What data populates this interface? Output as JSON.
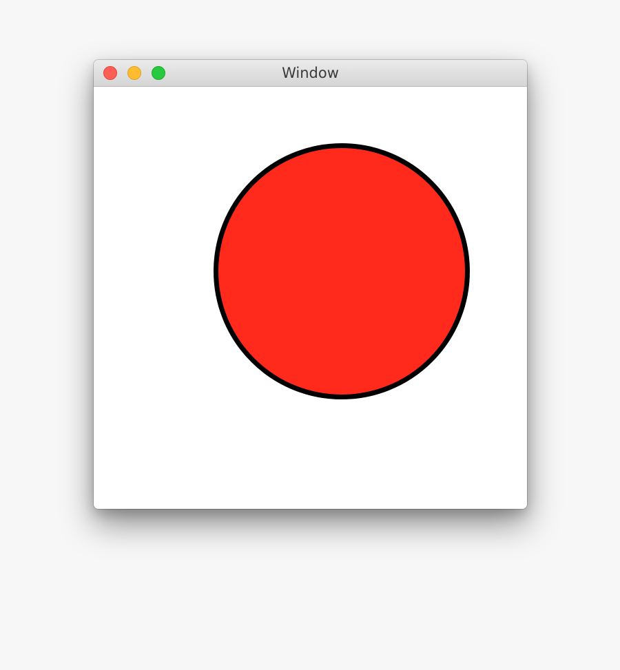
{
  "window": {
    "title": "Window"
  },
  "controls": {
    "close": {
      "icon": "close-icon",
      "color": "#fd5f57"
    },
    "minimize": {
      "icon": "minimize-icon",
      "color": "#febc2e"
    },
    "maximize": {
      "icon": "maximize-icon",
      "color": "#28c840"
    }
  },
  "canvas": {
    "shape": {
      "type": "circle",
      "fill": "#ff2a1b",
      "stroke": "#000000"
    }
  }
}
